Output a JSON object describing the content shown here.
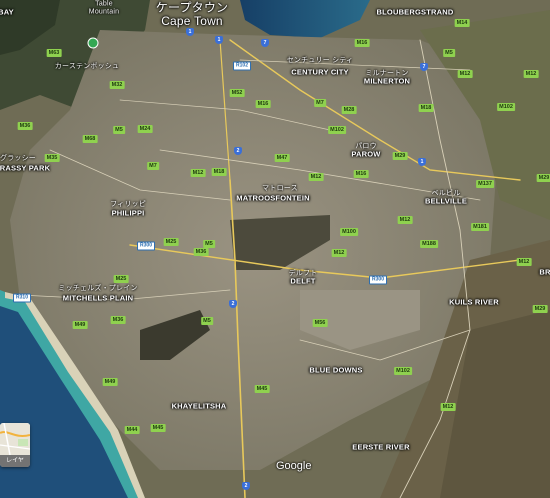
{
  "map": {
    "type": "satellite",
    "colors": {
      "land": "#6b6b52",
      "urban": "#8a8476",
      "ocean": "#1f4f7a",
      "shallow": "#3fa7a4",
      "beach": "#d9d2b8",
      "road_major": "#e8c95b",
      "road_minor": "#d8d0b8"
    },
    "city": {
      "jp": "ケープタウン",
      "en": "Cape Town"
    },
    "areas": [
      {
        "id": "bloubergstrand",
        "text": "BLOUBERGSTRAND",
        "style": "area"
      },
      {
        "id": "century-city-jp",
        "text": "センチュリー シティ",
        "style": "jp"
      },
      {
        "id": "century-city",
        "text": "CENTURY CITY",
        "style": "area"
      },
      {
        "id": "milnerton-jp",
        "text": "ミルナートン",
        "style": "jp"
      },
      {
        "id": "milnerton",
        "text": "MILNERTON",
        "style": "area"
      },
      {
        "id": "parow-jp",
        "text": "パロウ",
        "style": "jp"
      },
      {
        "id": "parow",
        "text": "PAROW",
        "style": "area"
      },
      {
        "id": "grassy-park-jp",
        "text": "グラッシー",
        "style": "jp"
      },
      {
        "id": "grassy-park",
        "text": "GRASSY PARK",
        "style": "area"
      },
      {
        "id": "matroosfontein-jp",
        "text": "マトロース",
        "style": "jp"
      },
      {
        "id": "matroosfontein",
        "text": "MATROOSFONTEIN",
        "style": "area"
      },
      {
        "id": "bellville-jp",
        "text": "ベルビル",
        "style": "jp"
      },
      {
        "id": "bellville",
        "text": "BELLVILLE",
        "style": "area"
      },
      {
        "id": "philippi-jp",
        "text": "フィリッピ",
        "style": "jp"
      },
      {
        "id": "philippi",
        "text": "PHILIPPI",
        "style": "area"
      },
      {
        "id": "mitchells-plain-jp",
        "text": "ミッチェルズ・プレイン",
        "style": "jp"
      },
      {
        "id": "mitchells-plain",
        "text": "MITCHELLS PLAIN",
        "style": "area"
      },
      {
        "id": "delft-jp",
        "text": "デルフト",
        "style": "jp"
      },
      {
        "id": "delft",
        "text": "DELFT",
        "style": "area"
      },
      {
        "id": "kuils-river",
        "text": "KUILS RIVER",
        "style": "area"
      },
      {
        "id": "blue-downs",
        "text": "BLUE DOWNS",
        "style": "area"
      },
      {
        "id": "khayelitsha",
        "text": "KHAYELITSHA",
        "style": "area"
      },
      {
        "id": "table-mountain-jp",
        "text": "カーステンボッシュ",
        "style": "jp"
      },
      {
        "id": "eerste-river",
        "text": "EERSTE RIVER",
        "style": "area"
      },
      {
        "id": "table-top",
        "text": "Table",
        "style": "jp"
      },
      {
        "id": "table-top-2",
        "text": "Mountain",
        "style": "jp"
      },
      {
        "id": "bay-edge",
        "text": "BAY",
        "style": "area"
      },
      {
        "id": "br-edge",
        "text": "BR",
        "style": "area"
      }
    ],
    "metro_routes": [
      "M5",
      "M7",
      "M12",
      "M13",
      "M14",
      "M16",
      "M18",
      "M22",
      "M24",
      "M25",
      "M28",
      "M29",
      "M32",
      "M35",
      "M36",
      "M44",
      "M45",
      "M47",
      "M49",
      "M52",
      "M53",
      "M54",
      "M56",
      "M57",
      "M63",
      "M65",
      "M68",
      "M71",
      "M100",
      "M102",
      "M117",
      "M137",
      "M181",
      "M188"
    ],
    "regional_routes": [
      "R300",
      "R102",
      "R310"
    ],
    "national_routes": [
      "1",
      "2",
      "7"
    ],
    "layers_button": {
      "label": "レイヤ"
    },
    "attribution": "Google"
  }
}
